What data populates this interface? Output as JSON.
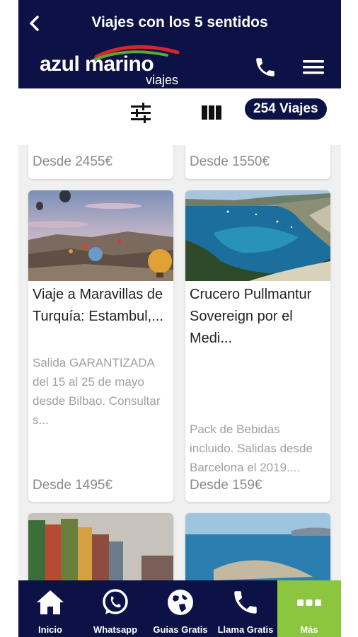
{
  "header": {
    "title": "Viajes con los 5 sentidos",
    "logo_main": "azul marino",
    "logo_sub": "viajes"
  },
  "toolbar": {
    "count": "254 Viajes"
  },
  "cards_partial": [
    {
      "price": "Desde 2455€"
    },
    {
      "price": "Desde 1550€"
    }
  ],
  "cards": [
    {
      "title": "Viaje a Maravillas de Turquía: Estambul,...",
      "description": "Salida GARANTIZADA del 15 al 25 de mayo desde Bilbao. Consultar s...",
      "price": "Desde 1495€",
      "image": "hot-air-balloons"
    },
    {
      "title": "Crucero Pullmantur Sovereign por el Medi...",
      "description": "Pack de Bebidas incluido. Salidas desde Barcelona el 2019....",
      "price": "Desde 159€",
      "image": "mediterranean-bay"
    }
  ],
  "nav": [
    {
      "label": "Inicio",
      "icon": "home-icon"
    },
    {
      "label": "Whatsapp",
      "icon": "whatsapp-icon"
    },
    {
      "label": "Guias Gratis",
      "icon": "globe-icon"
    },
    {
      "label": "Llama Gratis",
      "icon": "phone-icon"
    },
    {
      "label": "Más",
      "icon": "more-icon"
    }
  ],
  "colors": {
    "primary": "#0d1246",
    "accent": "#8cc63f"
  }
}
